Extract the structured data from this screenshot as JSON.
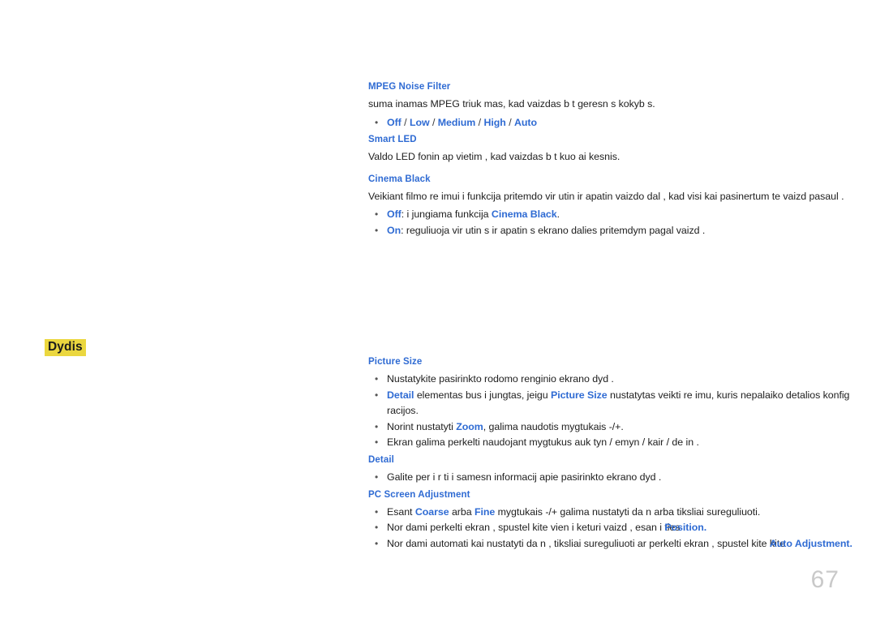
{
  "page": {
    "number": "67",
    "margin_label": "Dydis",
    "highlight_color": "#ebd73f",
    "accent_color": "#2f6bd3",
    "body_color": "#212121",
    "page_number_color": "#c9c9c9"
  },
  "sections": [
    {
      "id": "mpeg-noise-filter",
      "heading": "MPEG Noise Filter",
      "paragraph": "suma inamas MPEG triuk mas, kad vaizdas b t  geresn s kokyb s.",
      "options_bullet": {
        "marker": "•",
        "items": [
          "Off",
          "Low",
          "Medium",
          "High",
          "Auto"
        ],
        "separator": "/"
      }
    },
    {
      "id": "smart-led",
      "heading": "Smart LED",
      "paragraph": "Valdo LED fonin  ap vietim , kad vaizdas b t  kuo ai kesnis."
    },
    {
      "id": "cinema-black",
      "heading": "Cinema Black",
      "paragraph": "Veikiant filmo re imui  i funkcija pritemdo vir utin  ir apatin  vaizdo dal , kad visi kai pasinertum te   vaizd  pasaul .",
      "bullets": [
        {
          "marker": "•",
          "lead": "Off",
          "text_before": ": i jungiama funkcija ",
          "link": "Cinema Black",
          "text_after": "."
        },
        {
          "marker": "•",
          "lead": "On",
          "text_before": ": reguliuoja vir utin s ir apatin s ekrano dalies pritemdym  pagal vaizd .",
          "link": "",
          "text_after": ""
        }
      ]
    },
    {
      "id": "picture-size",
      "heading": "Picture Size",
      "bullets": [
        {
          "marker": "•",
          "text": "Nustatykite pasirinkto rodomo  renginio ekrano dyd ."
        },
        {
          "marker": "•",
          "kw_1": "Detail",
          "mid_1": " elementas bus i jungtas, jeigu ",
          "kw_2": "Picture Size",
          "tail": " nustatytas veikti re imu, kuris nepalaiko detalios konfig racijos."
        },
        {
          "marker": "•",
          "pre": "Norint nustatyti ",
          "kw": "Zoom",
          "post": ", galima naudotis mygtukais -/+."
        },
        {
          "marker": "•",
          "text": "Ekran  galima perkelti naudojant mygtukus auk tyn /  emyn /   kair  /   de in ."
        }
      ]
    },
    {
      "id": "detail",
      "heading": "Detail",
      "bullets": [
        {
          "marker": "•",
          "text": "Galite per i r ti i samesn  informacij  apie pasirinkto ekrano dyd ."
        }
      ]
    },
    {
      "id": "pc-screen-adjustment",
      "heading": "PC Screen Adjustment",
      "bullets": [
        {
          "marker": "•",
          "pre": "Esant ",
          "kw_1": "Coarse",
          "mid": " arba ",
          "kw_2": "Fine",
          "post": " mygtukais -/+ galima nustatyti da n  arba tiksliai sureguliuoti."
        },
        {
          "marker": "•",
          "pre": "Nor dami perkelti ekran , spustel kite vien  i  keturi  vaizd , esan i  ",
          "overlap_under": "ties ",
          "kw": "Position",
          "post": "."
        },
        {
          "marker": "•",
          "pre": "Nor dami automati kai nustatyti da n , tiksliai sureguliuoti ar perkelti ekran , spustel kite ",
          "overlap_under": "kite ",
          "kw": "Auto Adjustment",
          "post": "."
        }
      ]
    }
  ]
}
